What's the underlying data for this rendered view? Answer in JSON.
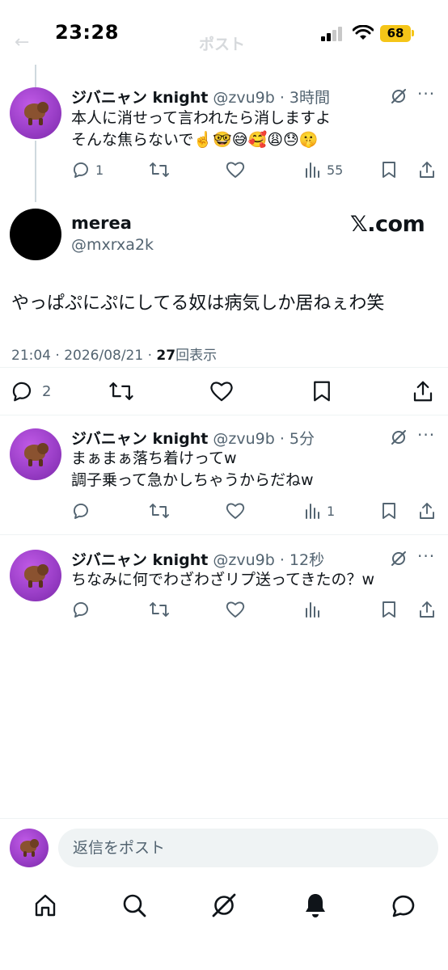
{
  "status_bar": {
    "time": "23:28",
    "battery": "68",
    "ghost_title": "ポスト",
    "ghost_back": "←"
  },
  "replies_top": [
    {
      "name": "ジバニャン knight",
      "handle": "@zvu9b",
      "time": "3時間",
      "lines": [
        "本人に消せって言われたら消しますよ",
        "そんな焦らないで☝️🤓😅🥰😩😓🤫"
      ],
      "reply_count": "1",
      "views": "55"
    }
  ],
  "main_tweet": {
    "name": "merea",
    "handle": "@mxrxa2k",
    "badge": "𝕏.com",
    "text": "やっぱぷにぷにしてる奴は病気しか居ねぇわ笑",
    "date": "21:04 · 2026/08/21 · ",
    "views_count": "27",
    "views_label": "回表示",
    "reply_count": "2"
  },
  "replies": [
    {
      "name": "ジバニャン knight",
      "handle": "@zvu9b",
      "time": "5分",
      "lines": [
        "まぁまぁ落ち着けってw",
        "調子乗って急かしちゃうからだねw"
      ],
      "views": "1"
    },
    {
      "name": "ジバニャン knight",
      "handle": "@zvu9b",
      "time": "12秒",
      "lines": [
        "ちなみに何でわざわざリプ送ってきたの？w"
      ],
      "views": ""
    }
  ],
  "reply_bar": {
    "placeholder": "返信をポスト"
  },
  "bottom_nav": [
    "home-icon",
    "search-icon",
    "grok-icon",
    "notifications-icon",
    "messages-icon"
  ],
  "colors": {
    "text": "#0f1419",
    "muted": "#536471",
    "battery": "#f5c518",
    "avatar": "#9b3fc8"
  }
}
